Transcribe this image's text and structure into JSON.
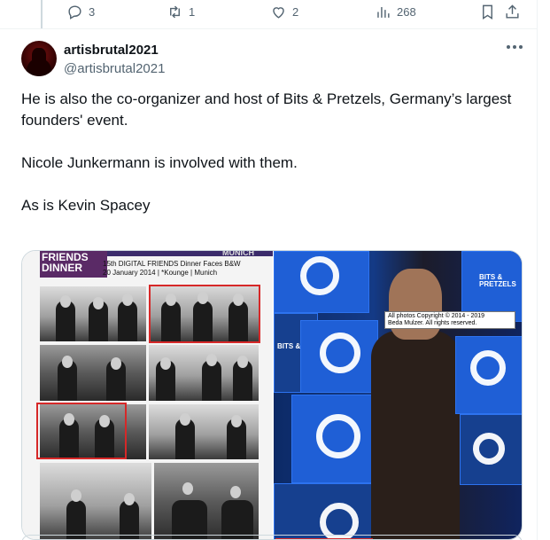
{
  "previous_tweet_actions": {
    "reply_count": "3",
    "retweet_count": "1",
    "like_count": "2",
    "views_count": "268"
  },
  "tweet": {
    "display_name": "artisbrutal2021",
    "handle": "@artisbrutal2021",
    "paragraphs": [
      "He is also the co-organizer and host of Bits & Pretzels, Germany’s largest founders' event.",
      "Nicole Junkermann is involved with them.",
      "As is Kevin Spacey"
    ]
  },
  "media": {
    "left_title": "FRIENDS DINNER",
    "left_header_right": "MUNICH",
    "left_subtitle_line1": "15th DIGITAL FRIENDS Dinner Faces B&W",
    "left_subtitle_line2": "20 January 2014   |   *Kounge   |   Munich",
    "copyright_line1": "All photos Copyright © 2014 - 2019",
    "copyright_line2": "Beda Mulzer. All rights reserved.",
    "brand_label_a": "BITS & PRETZELS",
    "brand_label_b": "BITS & PRETZELS"
  },
  "icons": {
    "reply": "reply-icon",
    "retweet": "retweet-icon",
    "like": "heart-icon",
    "views": "views-icon",
    "bookmark": "bookmark-icon",
    "share": "share-icon",
    "more": "more-icon"
  }
}
